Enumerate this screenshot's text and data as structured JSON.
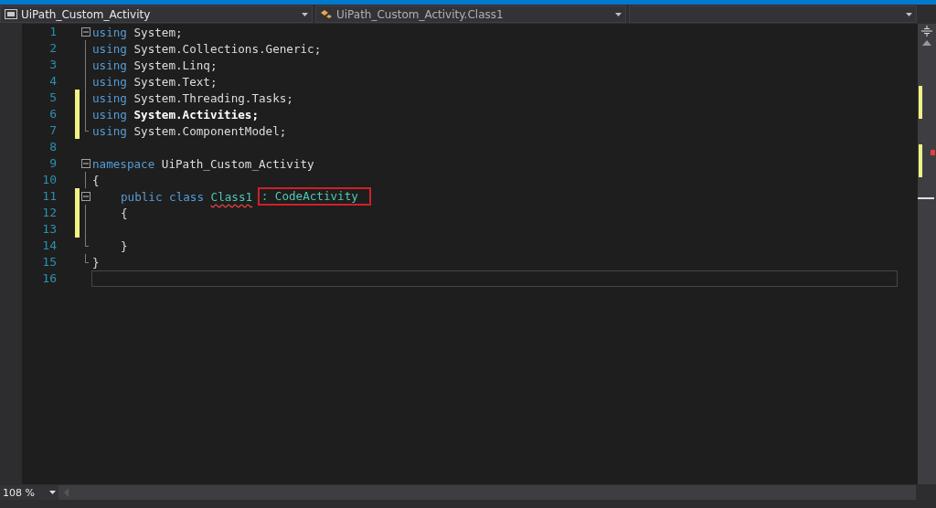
{
  "navigation_bar": {
    "project_dropdown": {
      "value": "UiPath_Custom_Activity"
    },
    "type_dropdown": {
      "value": "UiPath_Custom_Activity.Class1"
    }
  },
  "editor": {
    "lines": [
      {
        "number": "1",
        "changed": false,
        "fold_start": true,
        "tokens": [
          {
            "kind": "keyword",
            "text": "using"
          },
          {
            "kind": "plain",
            "text": "System;"
          }
        ]
      },
      {
        "number": "2",
        "changed": false,
        "tokens": [
          {
            "kind": "keyword",
            "text": "using"
          },
          {
            "kind": "plain",
            "text": "System.Collections.Generic;"
          }
        ]
      },
      {
        "number": "3",
        "changed": false,
        "tokens": [
          {
            "kind": "keyword",
            "text": "using"
          },
          {
            "kind": "plain",
            "text": "System.Linq;"
          }
        ]
      },
      {
        "number": "4",
        "changed": false,
        "tokens": [
          {
            "kind": "keyword",
            "text": "using"
          },
          {
            "kind": "plain",
            "text": "System.Text;"
          }
        ]
      },
      {
        "number": "5",
        "changed": true,
        "tokens": [
          {
            "kind": "keyword",
            "text": "using"
          },
          {
            "kind": "plain",
            "text": "System.Threading.Tasks;"
          }
        ]
      },
      {
        "number": "6",
        "changed": true,
        "tokens": [
          {
            "kind": "keyword",
            "text": "using"
          },
          {
            "kind": "strong",
            "text": "System.Activities;"
          }
        ]
      },
      {
        "number": "7",
        "changed": true,
        "fold_end": true,
        "tokens": [
          {
            "kind": "keyword",
            "text": "using"
          },
          {
            "kind": "plain",
            "text": "System.ComponentModel;"
          }
        ]
      },
      {
        "number": "8",
        "changed": false
      },
      {
        "number": "9",
        "changed": false,
        "fold_start": true,
        "tokens": [
          {
            "kind": "keyword",
            "text": "namespace"
          },
          {
            "kind": "plain",
            "text": "UiPath_Custom_Activity"
          }
        ]
      },
      {
        "number": "10",
        "changed": false,
        "tokens": [
          {
            "kind": "plain",
            "text": "{"
          }
        ],
        "children": [
          {
            "number": "11",
            "changed": true,
            "fold_start": true,
            "tokens": [
              {
                "kind": "keyword",
                "text": "public"
              },
              {
                "kind": "keyword",
                "text": "class"
              },
              {
                "kind": "error",
                "text": "Class1"
              },
              {
                "kind": "boxed",
                "text": ": CodeActivity"
              }
            ]
          },
          {
            "number": "12",
            "changed": true,
            "tokens": [
              {
                "kind": "plain",
                "text": "{"
              }
            ]
          },
          {
            "number": "13",
            "changed": true
          },
          {
            "number": "14",
            "changed": false,
            "fold_end": true,
            "tokens": [
              {
                "kind": "plain",
                "text": "}"
              }
            ]
          }
        ]
      },
      {
        "number": "15",
        "changed": false,
        "fold_end": true,
        "tokens": [
          {
            "kind": "plain",
            "text": "}"
          }
        ]
      },
      {
        "number": "16",
        "changed": false,
        "current": true
      }
    ]
  },
  "status_bar": {
    "zoom_dropdown": {
      "value": "108 %"
    }
  }
}
